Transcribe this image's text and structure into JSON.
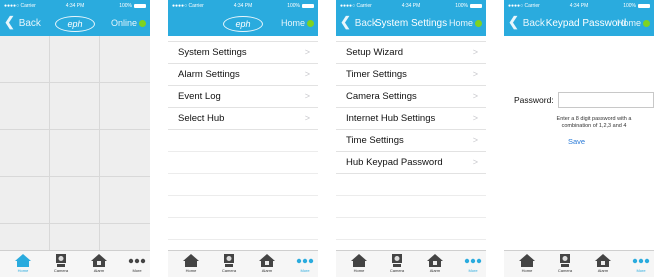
{
  "status_bar": {
    "carrier": "●●●●○ Carrier",
    "time": "4:34 PM",
    "battery": "100%"
  },
  "brand": "eph",
  "screen1": {
    "back_label": "Back",
    "right_label": "Online",
    "tabs": [
      "Home",
      "Camera",
      "Alarm",
      "More"
    ],
    "active_tab": "Home"
  },
  "screen2": {
    "right_label": "Home",
    "items": [
      {
        "label": "System Settings",
        "arrow": ">"
      },
      {
        "label": "Alarm Settings",
        "arrow": ">"
      },
      {
        "label": "Event Log",
        "arrow": ">"
      },
      {
        "label": "Select Hub",
        "arrow": ">"
      }
    ],
    "tabs": [
      "Home",
      "Camera",
      "Alarm",
      "More"
    ],
    "active_tab": "More"
  },
  "screen3": {
    "back_label": "Back",
    "title": "System Settings",
    "right_label": "Home",
    "items": [
      {
        "label": "Setup Wizard",
        "arrow": ">"
      },
      {
        "label": "Timer Settings",
        "arrow": ">"
      },
      {
        "label": "Camera Settings",
        "arrow": ">"
      },
      {
        "label": "Internet Hub Settings",
        "arrow": ">"
      },
      {
        "label": "Time Settings",
        "arrow": ">"
      },
      {
        "label": "Hub Keypad Password",
        "arrow": ">"
      }
    ],
    "tabs": [
      "Home",
      "Camera",
      "Alarm",
      "More"
    ],
    "active_tab": "More"
  },
  "screen4": {
    "back_label": "Back",
    "title": "Keypad Password",
    "right_label": "Home",
    "password_label": "Password:",
    "password_value": "",
    "hint": "Enter a 8 digit password with a combination of 1,2,3 and 4",
    "save_label": "Save",
    "tabs": [
      "Home",
      "Camera",
      "Alarm",
      "More"
    ],
    "active_tab": "More"
  },
  "colors": {
    "accent": "#2aabde",
    "online": "#7ed321",
    "link": "#2a7bd8"
  }
}
